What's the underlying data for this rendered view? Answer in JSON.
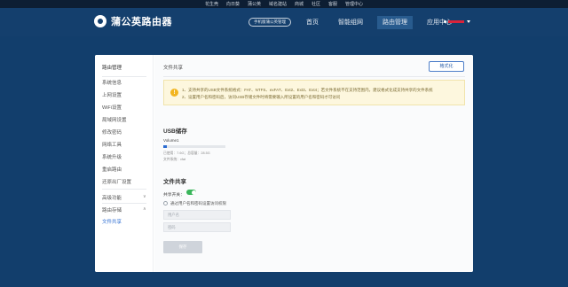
{
  "topbar": {
    "links": [
      "花生壳",
      "向日葵",
      "蒲公英",
      "域名建站",
      "商城",
      "社区",
      "客服",
      "管理中心"
    ]
  },
  "header": {
    "logo_text": "蒲公英路由器",
    "mobile_button": "手机版蒲公英管理",
    "nav": [
      {
        "label": "首页",
        "active": false
      },
      {
        "label": "智能组网",
        "active": false
      },
      {
        "label": "路由管理",
        "active": true
      },
      {
        "label": "应用中心",
        "active": false
      }
    ]
  },
  "sidebar": {
    "title": "路由管理",
    "items": [
      "系统信息",
      "上网设置",
      "WiFi设置",
      "局域网设置",
      "修改密码",
      "网络工具",
      "系统升级",
      "重启路由",
      "还原出厂设置"
    ],
    "groups": [
      {
        "label": "高级功能",
        "chevron": "∨"
      },
      {
        "label": "路由存储",
        "chevron": "∧"
      }
    ],
    "sub_items": [
      "文件共享"
    ],
    "active_item": "文件共享"
  },
  "content": {
    "title": "文件共享",
    "format_button": "格式化",
    "notice": {
      "icon": "!",
      "lines": [
        "1、支持共享的USB文件系统格式：FAT、NTFS、exFAT、Ext2、Ext3、Ext4；若文件系统不在支持范围内，建议格式化成支持共享的文件系统",
        "2、设置用户名和密码后，访问USB存储文件时将需要输入所设置的用户名和密码才可访问"
      ]
    },
    "usb": {
      "section_title": "USB储存",
      "volume_name": "Volume1",
      "used_fraction": 0.05,
      "usage_line": "已使用：7.6G；总容量：28.5G",
      "fs_line": "文件系统：vfat"
    },
    "share": {
      "section_title": "文件共享",
      "toggle_label": "共享开关：",
      "toggle_on": true,
      "auth_checkbox_label": "通过用户名和密码设置访问权限",
      "username_placeholder": "用户名",
      "password_placeholder": "密码",
      "save_button": "保存"
    }
  },
  "colors": {
    "header_bg": "#143f6d",
    "accent": "#2a6bd1",
    "toggle_on": "#39b55a",
    "notice_bg": "#fdf7de"
  }
}
